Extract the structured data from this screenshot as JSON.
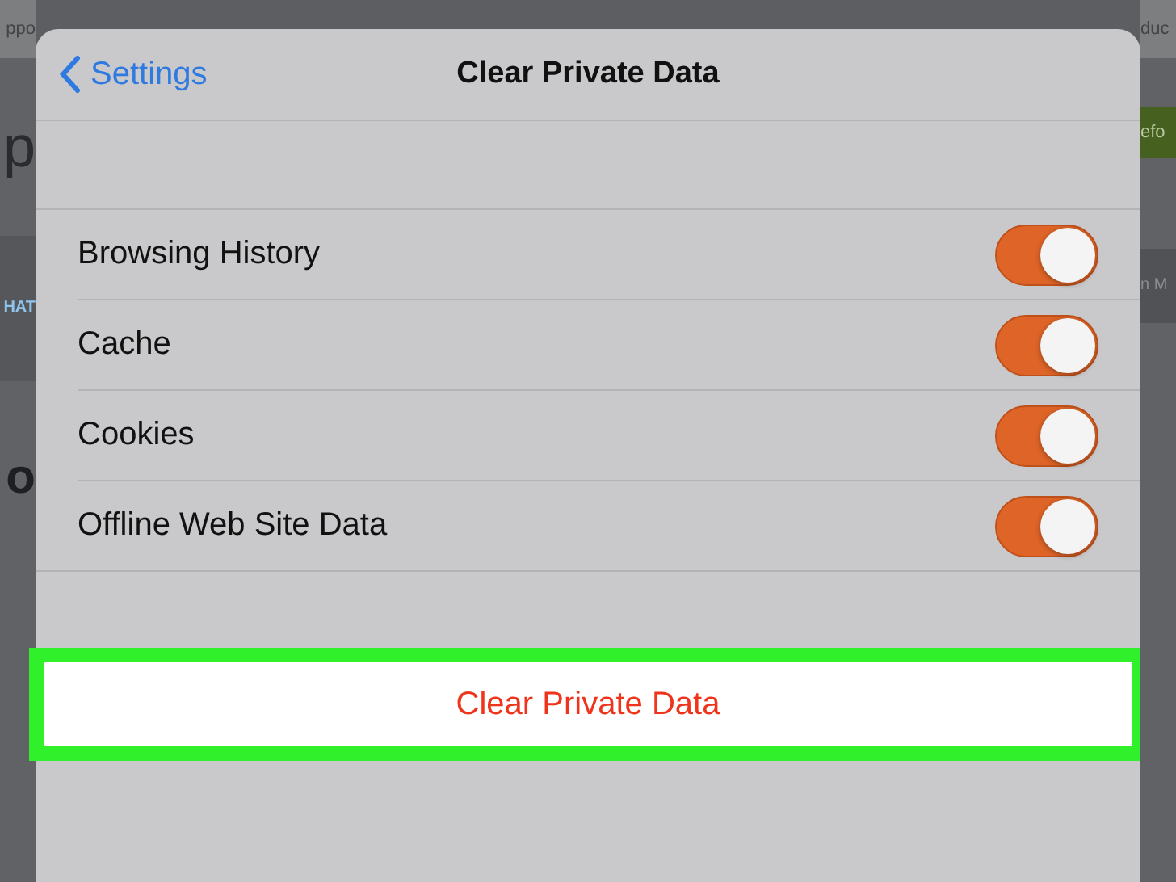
{
  "background": {
    "left": [
      "ppo",
      "p",
      "HAT",
      "o"
    ],
    "right": [
      "duc",
      "efo",
      "n M"
    ]
  },
  "dialog": {
    "back_label": "Settings",
    "title": "Clear Private Data",
    "rows": [
      {
        "label": "Browsing History",
        "on": true
      },
      {
        "label": "Cache",
        "on": true
      },
      {
        "label": "Cookies",
        "on": true
      },
      {
        "label": "Offline Web Site Data",
        "on": true
      }
    ],
    "action": {
      "label": "Clear Private Data",
      "highlighted": true
    }
  }
}
